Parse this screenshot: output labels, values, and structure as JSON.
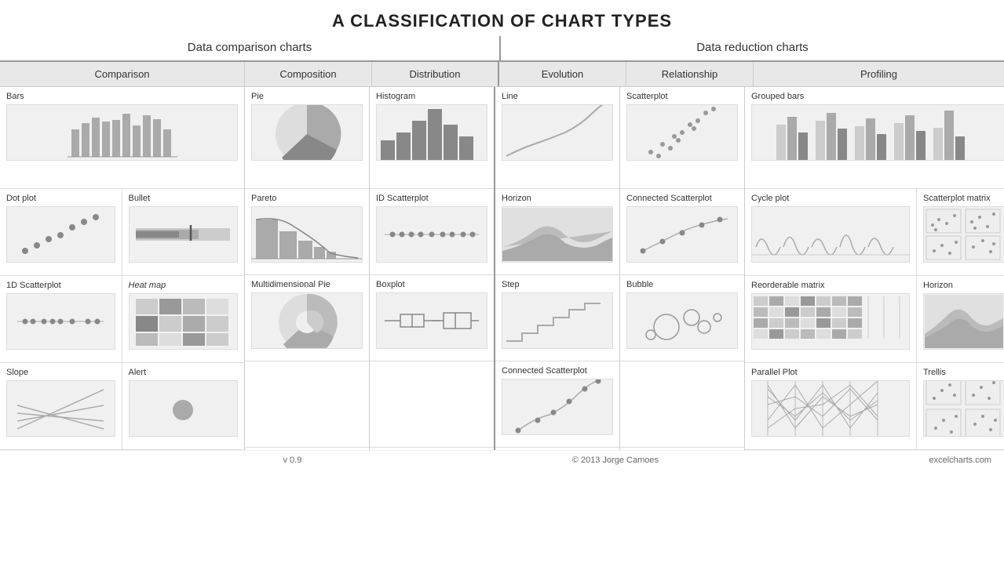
{
  "title": "A CLASSIFICATION OF CHART TYPES",
  "sections": {
    "left": "Data comparison charts",
    "right": "Data reduction charts"
  },
  "categories": {
    "comparison": "Comparison",
    "composition": "Composition",
    "distribution": "Distribution",
    "evolution": "Evolution",
    "relationship": "Relationship",
    "profiling": "Profiling"
  },
  "footer": {
    "version": "v 0.9",
    "author": "© 2013 Jorge Camoes",
    "site": "excelcharts.com"
  },
  "charts": {
    "bars": "Bars",
    "dot_plot": "Dot plot",
    "bullet": "Bullet",
    "id_scatterplot1": "ID Scatterplot",
    "heatmap": "Heat map",
    "id_scatterplot2": "1D Scatterplot",
    "slope": "Slope",
    "alert": "Alert",
    "pie": "Pie",
    "pareto": "Pareto",
    "multidimensional_pie": "Multidimensional Pie",
    "histogram": "Histogram",
    "id_scatterplot_dist": "ID Scatterplot",
    "boxplot": "Boxplot",
    "line": "Line",
    "horizon": "Horizon",
    "step": "Step",
    "connected_scatterplot_ev": "Connected Scatterplot",
    "scatterplot": "Scatterplot",
    "connected_scatterplot_rel": "Connected Scatterplot",
    "bubble": "Bubble",
    "grouped_bars": "Grouped bars",
    "cycle_plot": "Cycle plot",
    "scatterplot_matrix": "Scatterplot matrix",
    "reorderable_matrix": "Reorderable matrix",
    "horizon_prof": "Horizon",
    "parallel_plot": "Parallel Plot",
    "trellis": "Trellis"
  }
}
